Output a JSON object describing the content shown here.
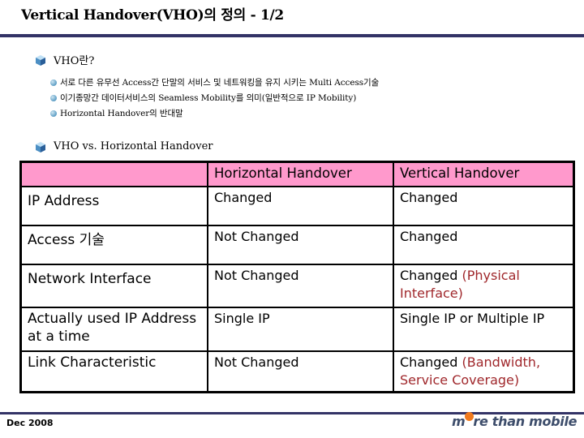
{
  "slide": {
    "title": "Vertical Handover(VHO)의 정의 - 1/2",
    "sections": [
      {
        "heading": "VHO란?",
        "bullets": [
          "서로 다른 유무선 Access간 단말의 서비스 및 네트워킹을 유지 시키는 Multi Access기술",
          "이기종망간 데이터서비스의 Seamless Mobility를 의미(일반적으로 IP Mobility)",
          "Horizontal Handover의 반대말"
        ]
      },
      {
        "heading": "VHO vs. Horizontal Handover"
      }
    ],
    "table": {
      "header_color": "#ff99cc",
      "columns": [
        "",
        "Horizontal Handover",
        "Vertical Handover"
      ],
      "rows": [
        {
          "attribute": "IP Address",
          "horizontal": "Changed",
          "vertical": "Changed",
          "vertical_note": ""
        },
        {
          "attribute": "Access 기술",
          "horizontal": "Not Changed",
          "vertical": "Changed",
          "vertical_note": ""
        },
        {
          "attribute": "Network Interface",
          "horizontal": "Not Changed",
          "vertical": "Changed",
          "vertical_note": "(Physical Interface)"
        },
        {
          "attribute": "Actually used IP Address at a time",
          "horizontal": "Single IP",
          "vertical": "Single IP or Multiple IP",
          "vertical_note": ""
        },
        {
          "attribute": "Link Characteristic",
          "horizontal": "Not Changed",
          "vertical": "Changed",
          "vertical_note": "(Bandwidth, Service Coverage)"
        }
      ]
    },
    "footer": {
      "date": "Dec 2008",
      "brand_prefix": "m",
      "brand_suffix": "re than mobile",
      "brand_dot_color": "#f07a1e"
    }
  }
}
